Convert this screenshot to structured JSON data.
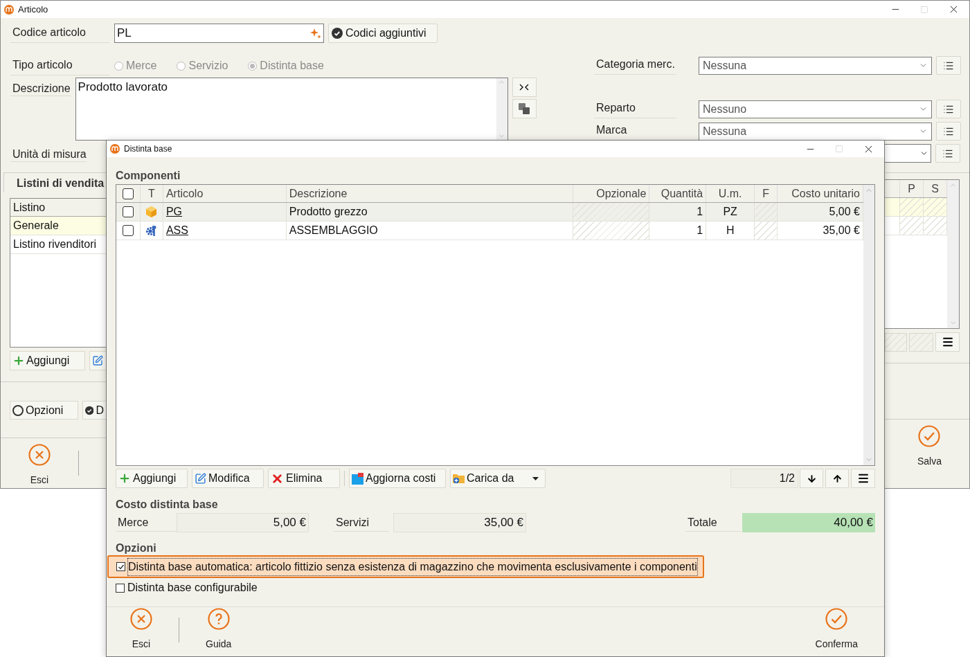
{
  "main_window": {
    "title": "Articolo",
    "code_field": {
      "label": "Codice articolo",
      "value": "PL"
    },
    "codes_button": "Codici aggiuntivi",
    "type_field": {
      "label": "Tipo articolo",
      "disabled": true,
      "options": [
        {
          "label": "Merce",
          "selected": false
        },
        {
          "label": "Servizio",
          "selected": false
        },
        {
          "label": "Distinta base",
          "selected": true
        }
      ]
    },
    "description_field": {
      "label": "Descrizione",
      "value": "Prodotto lavorato"
    },
    "right_fields": [
      {
        "label": "Categoria merc.",
        "value": "Nessuna"
      },
      {
        "label": "Reparto",
        "value": "Nessuno"
      },
      {
        "label": "Marca",
        "value": "Nessuna"
      }
    ],
    "unit_label": "Unità di misura",
    "tab": {
      "label": "Listini di vendita",
      "selected": true
    },
    "price_lists": {
      "column": "Listino",
      "right_columns": [
        "P",
        "S"
      ],
      "rows": [
        {
          "name": "Generale",
          "selected": true
        },
        {
          "name": "Listino rivenditori",
          "selected": false
        }
      ]
    },
    "list_add_button": "Aggiungi",
    "option_buttons": [
      {
        "label": "Opzioni",
        "kind": "radio"
      },
      {
        "label": "D",
        "kind": "check"
      }
    ],
    "footer": {
      "exit": "Esci",
      "save": "Salva"
    }
  },
  "dialog": {
    "title": "Distinta base",
    "section": "Componenti",
    "table": {
      "header_checked": false,
      "columns": [
        "T",
        "Articolo",
        "Descrizione",
        "Opzionale",
        "Quantità",
        "U.m.",
        "F",
        "Costo unitario"
      ],
      "rows": [
        {
          "checked": false,
          "current": true,
          "kind": "goods",
          "article": "PG",
          "description": "Prodotto grezzo",
          "quantity": "1",
          "unit": "PZ",
          "unit_cost": "5,00 €"
        },
        {
          "checked": false,
          "current": false,
          "kind": "service",
          "article": "ASS",
          "description": "ASSEMBLAGGIO",
          "quantity": "1",
          "unit": "H",
          "unit_cost": "35,00 €"
        }
      ]
    },
    "toolbar": [
      {
        "label": "Aggiungi",
        "kind": "add",
        "dropdown": false
      },
      {
        "label": "Modifica",
        "kind": "edit",
        "dropdown": false
      },
      {
        "label": "Elimina",
        "kind": "delete",
        "dropdown": false
      },
      {
        "label": "Aggiorna costi",
        "kind": "refresh",
        "dropdown": false
      },
      {
        "label": "Carica da",
        "kind": "load",
        "dropdown": true
      }
    ],
    "pager": "1/2",
    "costs": {
      "title": "Costo distinta base",
      "items": [
        {
          "label": "Merce",
          "value": "5,00 €"
        },
        {
          "label": "Servizi",
          "value": "35,00 €"
        }
      ],
      "total": {
        "label": "Totale",
        "value": "40,00 €"
      }
    },
    "options": {
      "title": "Opzioni",
      "items": [
        {
          "label": "Distinta base automatica: articolo fittizio senza esistenza di magazzino che movimenta esclusivamente i componenti",
          "checked": true,
          "focused": true
        },
        {
          "label": "Distinta base configurabile",
          "checked": false,
          "focused": false
        }
      ]
    },
    "footer": [
      {
        "label": "Esci",
        "kind": "exit"
      },
      {
        "label": "Guida",
        "kind": "help"
      },
      {
        "label": "Conferma",
        "kind": "confirm"
      }
    ]
  }
}
